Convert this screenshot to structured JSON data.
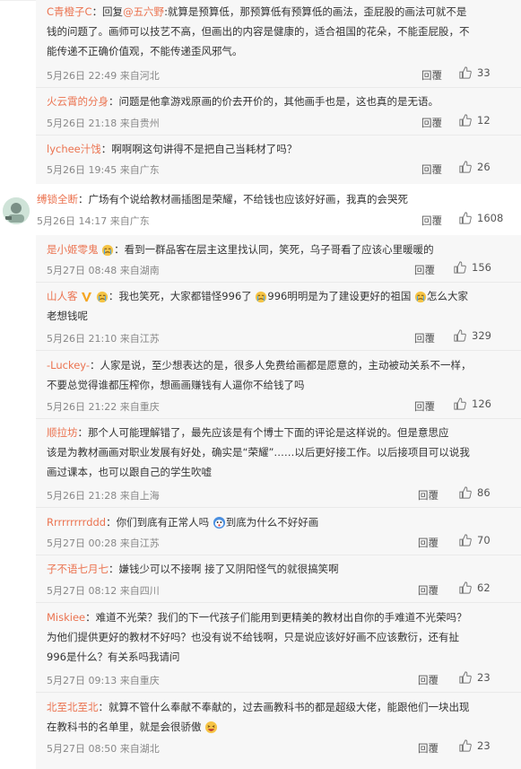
{
  "comments": [
    {
      "user": "C青橙子C",
      "sep": "：回复",
      "mention": "@五六野",
      "text1": ":就算是预算低，那预算低有预算低的画法，歪屁股的画法可就不是",
      "text2": "钱的问题了。画师可以技艺不高，但画出的内容是健康的，适合祖国的花朵，不能歪屁股，不",
      "text3": "能传递不正确价值观，不能传递歪风邪气。",
      "time": "5月26日 22:49 来自河北",
      "reply": "回覆",
      "likes": "33"
    },
    {
      "user": "火云霄的分身",
      "sep": "：",
      "text1": "问题是他拿游戏原画的价去开价的，其他画手也是，这也真的是无语。",
      "time": "5月26日 21:18 来自贵州",
      "reply": "回覆",
      "likes": "12"
    },
    {
      "user": "lychee汁饯",
      "sep": "：",
      "text1": "啊啊啊这句讲得不是把自己当耗材了吗？",
      "time": "5月26日 19:45 来自广东",
      "reply": "回覆",
      "likes": "26"
    },
    {
      "user": "缚锁全断",
      "sep": "：",
      "text1": "广场有个说给教材画插图是荣耀，不给钱也应该好好画，我真的会哭死",
      "time": "5月26日 14:17 来自广东",
      "reply": "回覆",
      "likes": "1608"
    },
    {
      "user": "是小姬零鬼",
      "sep": "：",
      "text1": "看到一群品客在层主这里找认同，笑死，乌子哥看了应该心里暖暖的",
      "time": "5月27日 08:48 来自湖南",
      "reply": "回覆",
      "likes": "156"
    },
    {
      "user": "山人客",
      "sep": "：",
      "text1a": "我也笑死，大家都错怪996了",
      "text1b": "996明明是为了建设更好的祖国",
      "text1c": "怎么大家",
      "text2": "老想钱呢",
      "time": "5月26日 21:10 来自江苏",
      "reply": "回覆",
      "likes": "329"
    },
    {
      "user": "-Luckey-",
      "sep": "：",
      "text1": "人家是说，至少想表达的是，很多人免费给画都是愿意的，主动被动关系不一样，",
      "text2": "不要总觉得谁都压榨你，想画画赚钱有人逼你不给钱了吗",
      "time": "5月26日 21:22 来自重庆",
      "reply": "回覆",
      "likes": "126"
    },
    {
      "user": "顺拉坊",
      "sep": "：",
      "text1": "那个人可能理解错了，最先应该是有个博士下面的评论是这样说的。但是意思应",
      "text2": "该是为教材画画对职业发展有好处，确实是“荣耀”……以后更好接工作。以后接项目可以说我",
      "text3": "画过课本，也可以跟自己的学生吹嘘",
      "time": "5月26日 21:28 来自上海",
      "reply": "回覆",
      "likes": "86"
    },
    {
      "user": "Rrrrrrrrrddd",
      "sep": "：",
      "text1a": "你们到底有正常人吗",
      "text1b": "到底为什么不好好画",
      "time": "5月27日 00:28 来自江苏",
      "reply": "回覆",
      "likes": "70"
    },
    {
      "user": "子不语七月七",
      "sep": "：",
      "text1": "嫌钱少可以不接啊 接了又阴阳怪气的就很搞笑啊",
      "time": "5月27日 08:12 来自四川",
      "reply": "回覆",
      "likes": "62"
    },
    {
      "user": "Miskiee",
      "sep": "：",
      "text1": "难道不光荣？我们的下一代孩子们能用到更精美的教材出自你的手难道不光荣吗？",
      "text2": "为他们提供更好的教材不好吗？也没有说不给钱啊，只是说应该好好画不应该敷衍，还有扯",
      "text3": "996是什么？有关系吗我请问",
      "time": "5月27日 09:13 来自重庆",
      "reply": "回覆",
      "likes": "23"
    },
    {
      "user": "北至北至北",
      "sep": "：",
      "text1": "就算不管什么奉献不奉献的，过去画教科书的都是超级大佬，能跟他们一块出现",
      "text2": "在教科书的名单里，就是会很骄傲",
      "time": "5月27日 08:50 来自湖北",
      "reply": "回覆",
      "likes": "23"
    }
  ],
  "colors": {
    "username": "#eb7350",
    "mention": "#eb7350",
    "meta": "#888888",
    "reply_bg": "#f7f7f7"
  },
  "icons": {
    "like": "thumbs-up-icon",
    "vip": "vip-v-icon",
    "emoji_cry": "crying-emoji-icon",
    "emoji_surprised": "surprised-emoji-icon",
    "emoji_laugh": "laughing-emoji-icon"
  }
}
